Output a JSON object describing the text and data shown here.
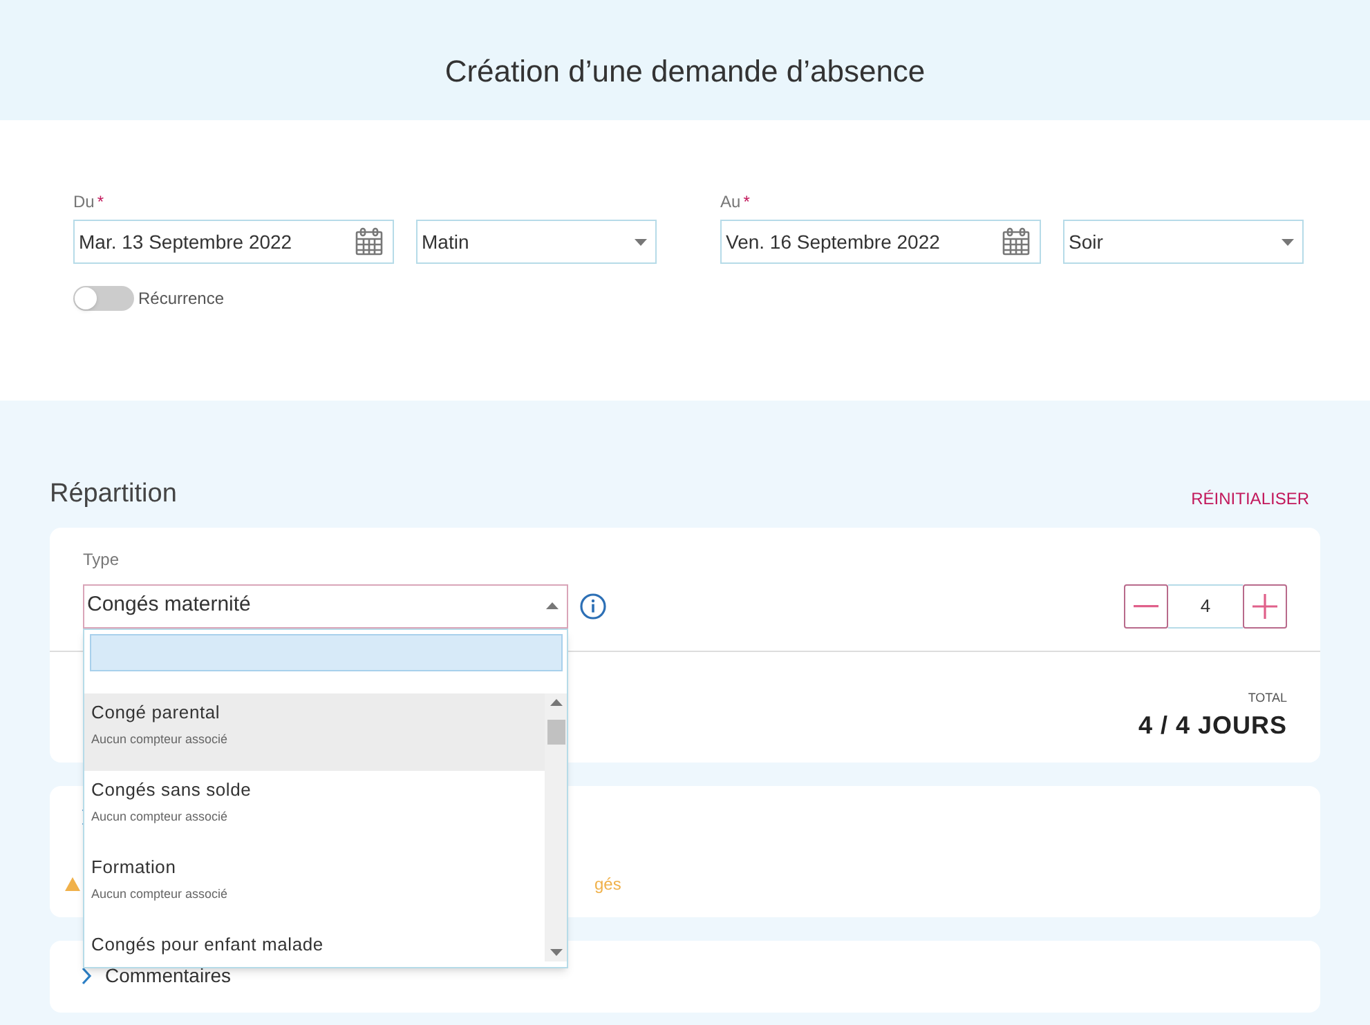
{
  "title": "Création d’une demande d’absence",
  "period": {
    "start": {
      "label": "Du",
      "required_mark": "*",
      "date": "Mar. 13 Septembre 2022",
      "half_day": "Matin"
    },
    "end": {
      "label": "Au",
      "required_mark": "*",
      "date": "Ven. 16 Septembre 2022",
      "half_day": "Soir"
    },
    "recurrence": {
      "label": "Récurrence",
      "on": false
    }
  },
  "allocation": {
    "title": "Répartition",
    "reset": "RÉINITIALISER",
    "type": {
      "label": "Type",
      "value": "Congés maternité",
      "expanded": true,
      "options": [
        {
          "name": "Congé parental",
          "note": "Aucun compteur associé",
          "selected": true
        },
        {
          "name": "Congés sans solde",
          "note": "Aucun compteur associé",
          "selected": false
        },
        {
          "name": "Formation",
          "note": "Aucun compteur associé",
          "selected": false
        },
        {
          "name": "Congés pour enfant malade",
          "selected": false
        }
      ]
    },
    "quantity": "4",
    "total_label": "TOTAL",
    "total": "4 / 4 JOURS"
  },
  "details": {
    "expanded": false,
    "warning": "gés"
  },
  "comments": {
    "label": "Commentaires",
    "expanded": false
  }
}
